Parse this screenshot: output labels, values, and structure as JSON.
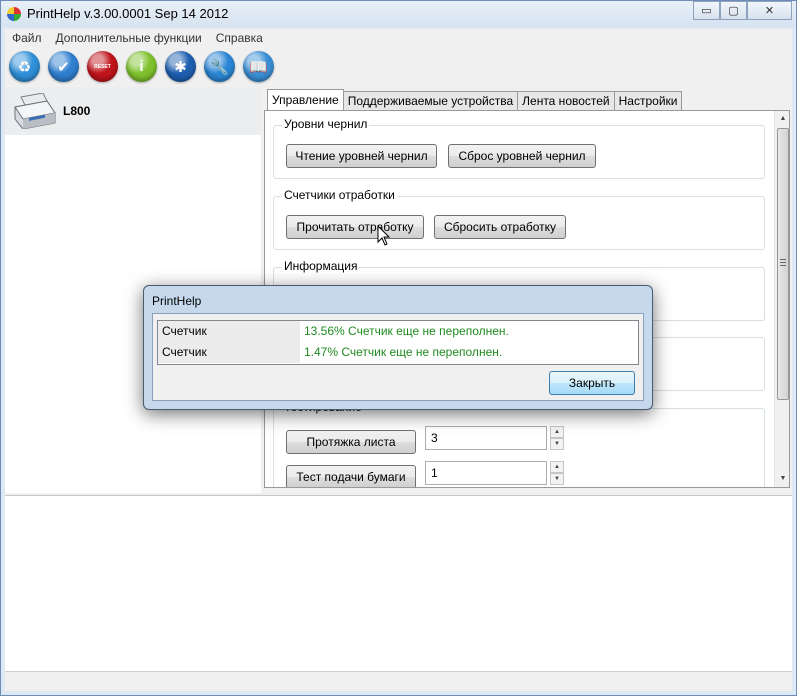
{
  "window": {
    "title": "PrintHelp v.3.00.0001 Sep 14 2012",
    "controls": {
      "minimize": "▭",
      "maximize": "▢",
      "close": "✕"
    }
  },
  "menu": [
    "Файл",
    "Дополнительные функции",
    "Справка"
  ],
  "toolbar": [
    {
      "name": "refresh",
      "icon": "recycle-icon",
      "color": "#2f8fd8",
      "glyph": "♻"
    },
    {
      "name": "check",
      "icon": "checkmark-icon",
      "color": "#2f7fd0",
      "glyph": "✔"
    },
    {
      "name": "reset",
      "icon": "reset-icon",
      "color": "#c0141b",
      "glyph": "RESET"
    },
    {
      "name": "info",
      "icon": "info-icon",
      "color": "#7ec12c",
      "glyph": "i"
    },
    {
      "name": "settings",
      "icon": "settings-icon",
      "color": "#1d5fb0",
      "glyph": "✱"
    },
    {
      "name": "tools",
      "icon": "wrench-icon",
      "color": "#2a86d4",
      "glyph": "🔧"
    },
    {
      "name": "help",
      "icon": "book-icon",
      "color": "#3a8fd6",
      "glyph": "📖"
    }
  ],
  "device": {
    "name": "L800"
  },
  "tabs": [
    {
      "label": "Управление",
      "active": true
    },
    {
      "label": "Поддерживаемые устройства",
      "active": false
    },
    {
      "label": "Лента новостей",
      "active": false
    },
    {
      "label": "Настройки",
      "active": false
    }
  ],
  "groups": {
    "ink_levels": {
      "title": "Уровни чернил",
      "read_button": "Чтение уровней чернил",
      "reset_button": "Сброс уровней чернил"
    },
    "counters": {
      "title": "Счетчики отработки",
      "read_button": "Прочитать отработку",
      "reset_button": "Сбросить отработку"
    },
    "info": {
      "title": "Информация"
    },
    "testing": {
      "title": "Тестирование",
      "feed_button": "Протяжка листа",
      "feed_value": "3",
      "paper_button": "Тест подачи бумаги",
      "paper_value": "1"
    }
  },
  "dialog": {
    "title": "PrintHelp",
    "rows": [
      {
        "label": "Счетчик",
        "message": "13.56% Счетчик еще не переполнен."
      },
      {
        "label": "Счетчик",
        "message": "1.47% Счетчик еще не переполнен."
      }
    ],
    "close_button": "Закрыть"
  }
}
